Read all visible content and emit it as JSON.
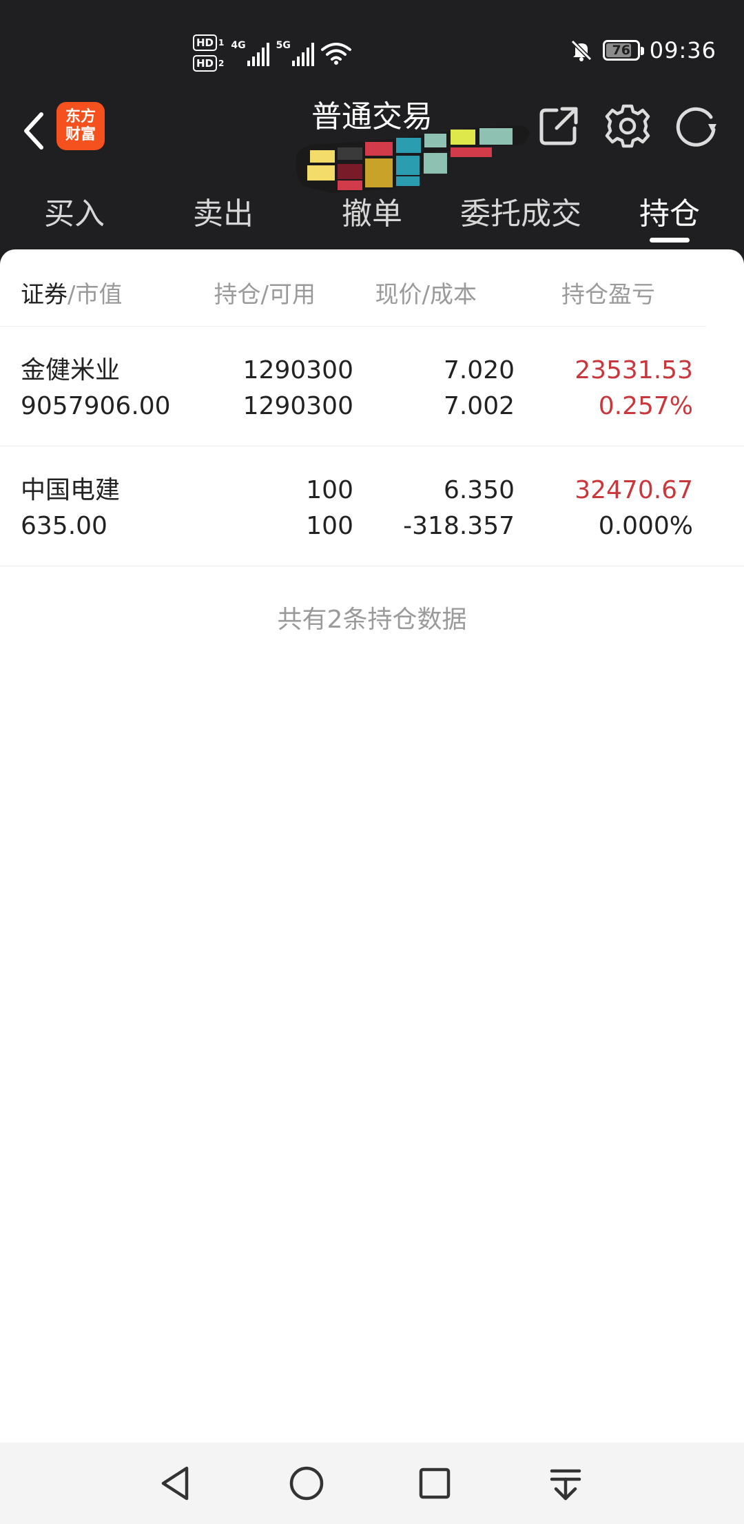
{
  "status_bar": {
    "sim1": "HD",
    "sim1_num": "1",
    "sim2": "HD",
    "sim2_num": "2",
    "net1": "4G",
    "net2": "5G",
    "battery": "76",
    "time": "09:36"
  },
  "header": {
    "title": "普通交易",
    "logo_line1": "东方",
    "logo_line2": "财富",
    "logo_color": "#f4511e"
  },
  "tabs": [
    {
      "label": "买入",
      "active": false
    },
    {
      "label": "卖出",
      "active": false
    },
    {
      "label": "撤单",
      "active": false
    },
    {
      "label": "委托成交",
      "active": false
    },
    {
      "label": "持仓",
      "active": true
    }
  ],
  "table": {
    "headers": {
      "col1_main": "证券",
      "col1_sub": "/市值",
      "col2": "持仓/可用",
      "col3": "现价/成本",
      "col4": "持仓盈亏"
    },
    "rows": [
      {
        "name": "金健米业",
        "market_value": "9057906.00",
        "holding": "1290300",
        "available": "1290300",
        "price": "7.020",
        "cost": "7.002",
        "pnl": "23531.53",
        "pnl_pct": "0.257%"
      },
      {
        "name": "中国电建",
        "market_value": "635.00",
        "holding": "100",
        "available": "100",
        "price": "6.350",
        "cost": "-318.357",
        "pnl": "32470.67",
        "pnl_pct": "0.000%"
      }
    ],
    "summary": "共有2条持仓数据"
  },
  "colors": {
    "profit_red": "#c8373c",
    "header_bg": "#1f1f21"
  }
}
